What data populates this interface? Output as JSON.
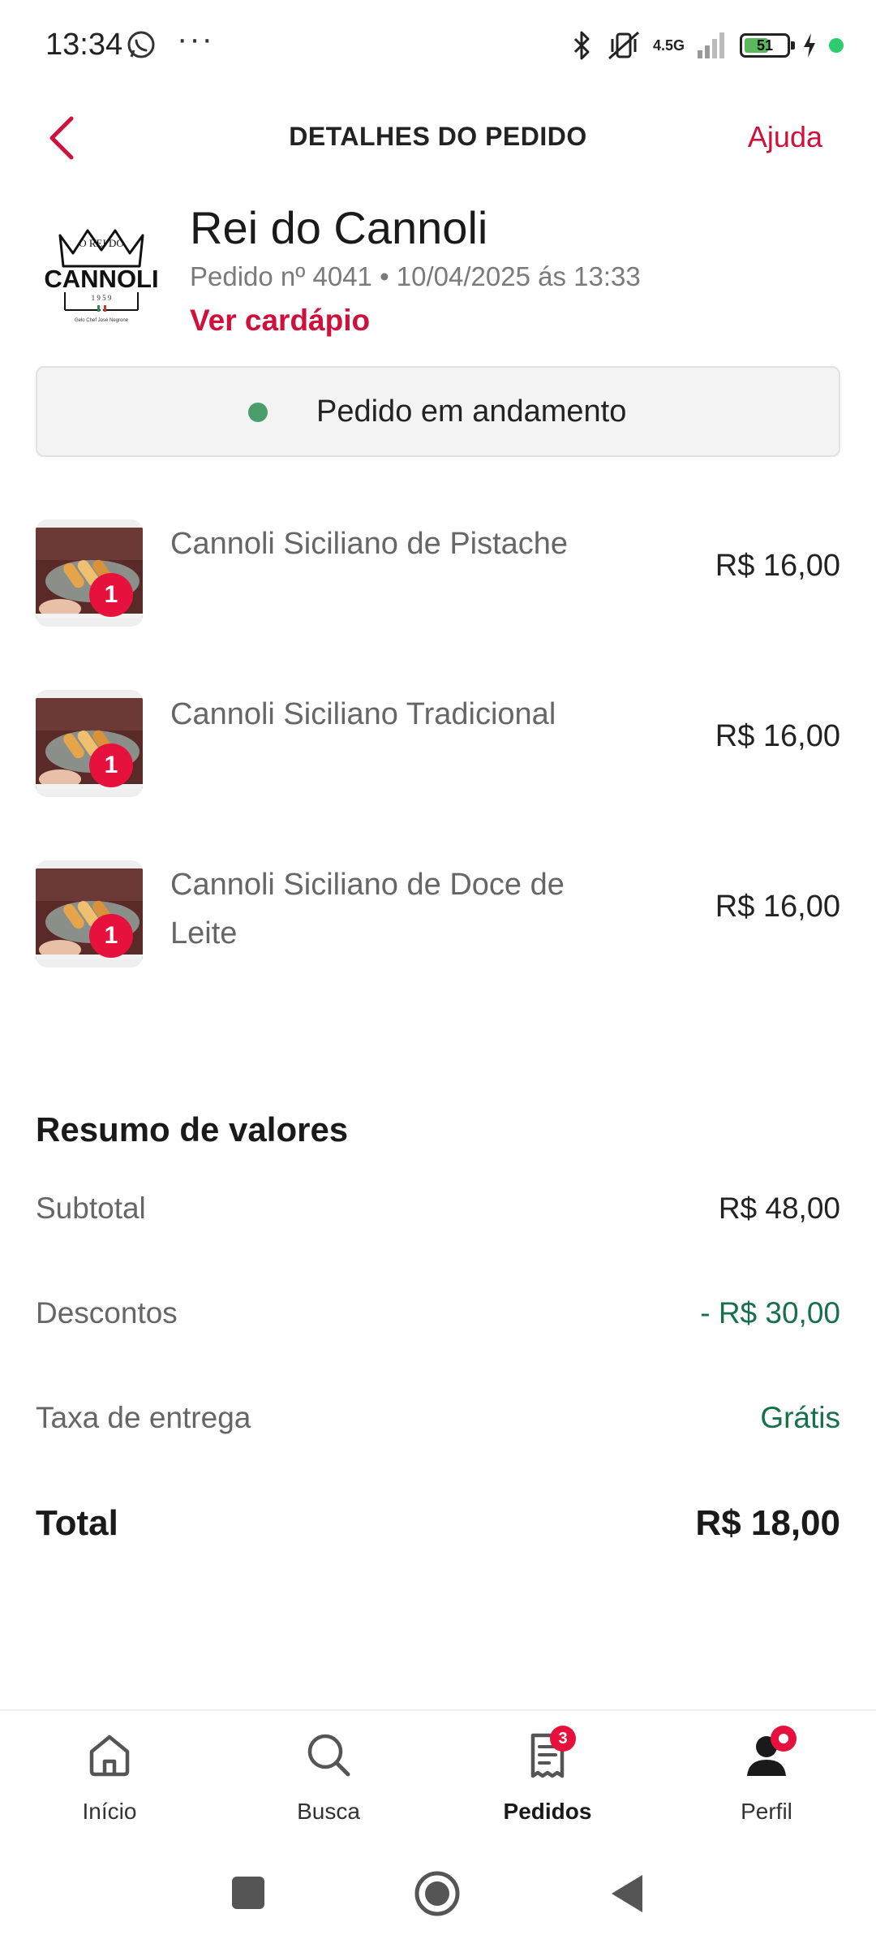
{
  "status_bar": {
    "time": "13:34",
    "dots": "···",
    "network": "4.5G",
    "battery_level": "51"
  },
  "header": {
    "title": "DETALHES DO PEDIDO",
    "help": "Ajuda"
  },
  "restaurant": {
    "name": "Rei do Cannoli",
    "order_meta": "Pedido nº 4041 • 10/04/2025 ás 13:33",
    "menu_link": "Ver cardápio",
    "logo_text": {
      "top": "O REI DO",
      "main": "CANNOLI",
      "year": "1 9 5 9",
      "sub": "Gelo Chef José Negrone"
    }
  },
  "order_status": {
    "text": "Pedido em andamento",
    "color": "#4a9e6b"
  },
  "items": [
    {
      "name": "Cannoli Siciliano de Pistache",
      "price": "R$ 16,00",
      "qty": "1"
    },
    {
      "name": "Cannoli Siciliano Tradicional",
      "price": "R$ 16,00",
      "qty": "1"
    },
    {
      "name": "Cannoli Siciliano de Doce de Leite",
      "price": "R$ 16,00",
      "qty": "1"
    }
  ],
  "summary": {
    "title": "Resumo de valores",
    "subtotal_label": "Subtotal",
    "subtotal_value": "R$ 48,00",
    "discount_label": "Descontos",
    "discount_value": "- R$ 30,00",
    "delivery_label": "Taxa de entrega",
    "delivery_value": "Grátis",
    "total_label": "Total",
    "total_value": "R$ 18,00"
  },
  "bottom_nav": {
    "items": [
      {
        "label": "Início",
        "icon": "home-icon"
      },
      {
        "label": "Busca",
        "icon": "search-icon"
      },
      {
        "label": "Pedidos",
        "icon": "receipt-icon",
        "badge": "3",
        "active": true
      },
      {
        "label": "Perfil",
        "icon": "person-icon"
      }
    ]
  },
  "colors": {
    "accent": "#d0103a",
    "badge": "#e6113c",
    "positive": "#16704a"
  }
}
